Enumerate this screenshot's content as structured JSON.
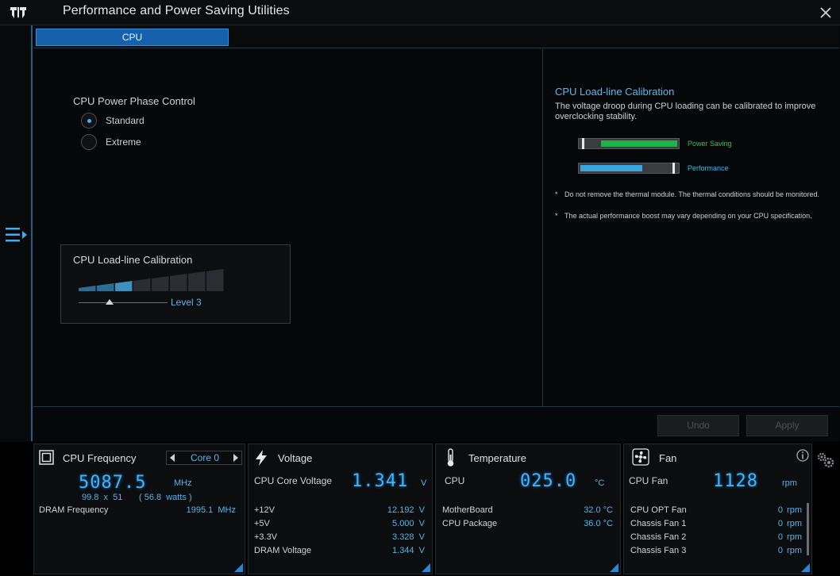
{
  "window": {
    "title": "Performance and Power Saving Utilities"
  },
  "tabs": [
    {
      "label": "CPU"
    }
  ],
  "phase_control": {
    "label": "CPU Power Phase Control",
    "options": [
      {
        "label": "Standard",
        "selected": true
      },
      {
        "label": "Extreme",
        "selected": false
      }
    ]
  },
  "llc": {
    "title": "CPU Load-line Calibration",
    "level_label": "Level 3",
    "level": 3,
    "levels_total": 8
  },
  "description": {
    "title": "CPU Load-line Calibration",
    "text": "The voltage droop during CPU loading can be calibrated to improve overclocking stability.",
    "legend": [
      {
        "label": "Power Saving",
        "color": "#22b24c"
      },
      {
        "label": "Performance",
        "color": "#3aa6e0"
      }
    ],
    "notes": [
      "Do not remove the thermal module. The thermal conditions should be monitored.",
      "The actual performance boost may vary depending on your CPU specification."
    ]
  },
  "buttons": {
    "undo": "Undo",
    "apply": "Apply"
  },
  "cpu_frequency": {
    "title": "CPU Frequency",
    "core_label": "Core 0",
    "value": "5087.5",
    "unit": "MHz",
    "detail_ratio": "99.8  x  51",
    "detail_power": "( 56.8  watts )",
    "dram_label": "DRAM Frequency",
    "dram_value": "1995.1  MHz"
  },
  "voltage": {
    "title": "Voltage",
    "main_label": "CPU Core Voltage",
    "main_value": "1.341",
    "main_unit": "V",
    "rows": [
      {
        "label": "+12V",
        "value": "12.192  V"
      },
      {
        "label": "+5V",
        "value": "5.000  V"
      },
      {
        "label": "+3.3V",
        "value": "3.328  V"
      },
      {
        "label": "DRAM Voltage",
        "value": "1.344  V"
      }
    ]
  },
  "temperature": {
    "title": "Temperature",
    "main_label": "CPU",
    "main_value": "025.0",
    "main_unit": "°C",
    "rows": [
      {
        "label": "MotherBoard",
        "value": "32.0 °C"
      },
      {
        "label": "CPU Package",
        "value": "36.0 °C"
      }
    ]
  },
  "fan": {
    "title": "Fan",
    "main_label": "CPU Fan",
    "main_value": "1128",
    "main_unit": "rpm",
    "rows": [
      {
        "label": "CPU OPT Fan",
        "value": "0",
        "unit": "rpm"
      },
      {
        "label": "Chassis Fan 1",
        "value": "0",
        "unit": "rpm"
      },
      {
        "label": "Chassis Fan 2",
        "value": "0",
        "unit": "rpm"
      },
      {
        "label": "Chassis Fan 3",
        "value": "0",
        "unit": "rpm"
      }
    ]
  },
  "icons": [
    "tuf-logo-icon",
    "close-icon",
    "menu-icon",
    "cpu-chip-icon",
    "lightning-icon",
    "thermometer-icon",
    "fan-icon",
    "info-icon",
    "gear-icon"
  ]
}
